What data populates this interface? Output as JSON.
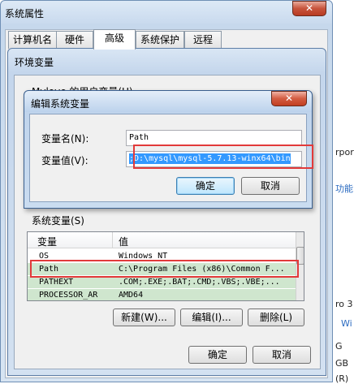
{
  "background": {
    "right_snippets": [
      {
        "text": "rpor"
      },
      {
        "text": "功能"
      },
      {
        "text": "ro 3"
      },
      {
        "text": "Wi"
      },
      {
        "text": "G"
      },
      {
        "text": "GB"
      },
      {
        "text": "(R)"
      }
    ]
  },
  "system_properties": {
    "title": "系统属性",
    "close_glyph": "✕",
    "tabs": [
      {
        "label": "计算机名",
        "active": false
      },
      {
        "label": "硬件",
        "active": false
      },
      {
        "label": "高级",
        "active": true
      },
      {
        "label": "系统保护",
        "active": false
      },
      {
        "label": "远程",
        "active": false
      }
    ]
  },
  "environment_variables": {
    "title": "环境变量",
    "user_vars_label": "Mylove 的用户变量(U)",
    "system_vars_label": "系统变量(S)",
    "columns": [
      "变量",
      "值"
    ],
    "rows": [
      {
        "name": "OS",
        "value": "Windows_NT",
        "selected": false
      },
      {
        "name": "Path",
        "value": "C:\\Program Files (x86)\\Common F...",
        "selected": true
      },
      {
        "name": "PATHEXT",
        "value": ".COM;.EXE;.BAT;.CMD;.VBS;.VBE;...",
        "selected": false
      },
      {
        "name": "PROCESSOR_AR",
        "value": "AMD64",
        "selected": false
      }
    ],
    "new_button": "新建(W)...",
    "edit_button": "编辑(I)...",
    "delete_button": "删除(L)",
    "ok_button": "确定",
    "cancel_button": "取消"
  },
  "edit_dialog": {
    "title": "编辑系统变量",
    "close_glyph": "✕",
    "name_label": "变量名(N):",
    "name_value": "Path",
    "value_label": "变量值(V):",
    "value_text": ";D:\\mysql\\mysql-5.7.13-winx64\\bin",
    "ok_button": "确定",
    "cancel_button": "取消"
  },
  "colors": {
    "selection_blue": "#3399ff",
    "row_selected": "#cfe6ce",
    "annotation_red": "#e23a3a",
    "close_red": "#c7543c"
  }
}
